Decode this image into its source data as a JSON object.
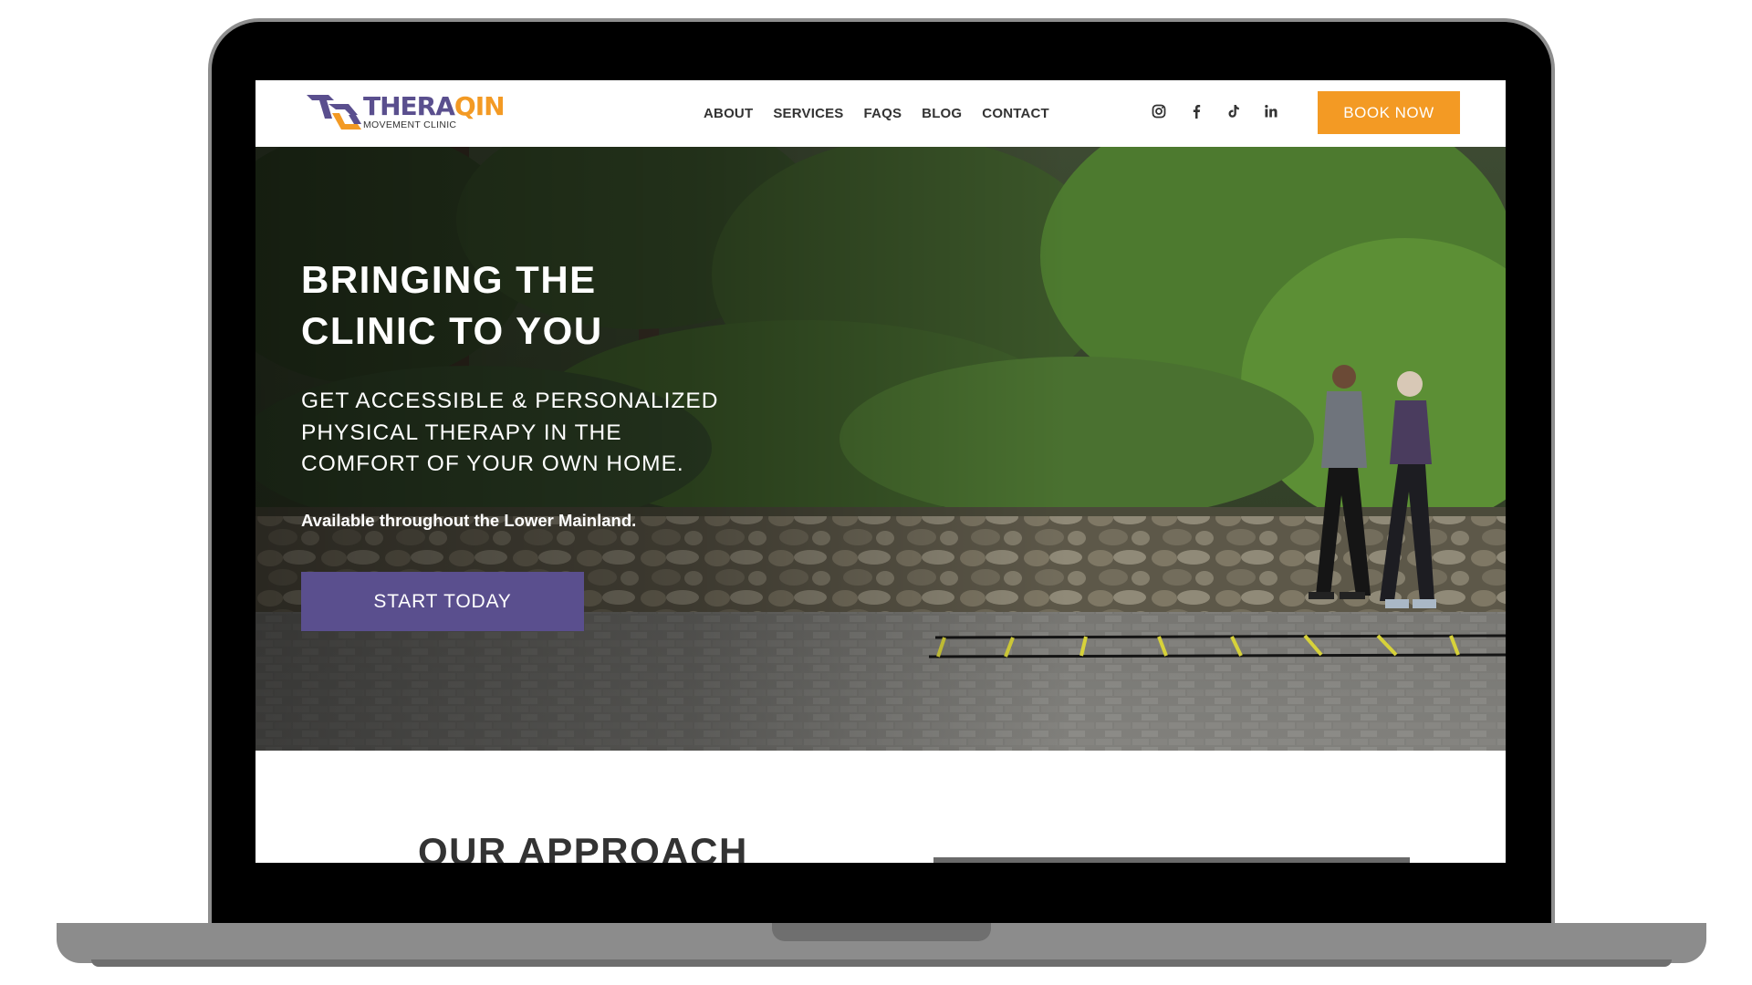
{
  "brand": {
    "name_part1": "THERA",
    "name_part2": "QIN",
    "tagline": "MOVEMENT CLINIC",
    "primary_color": "#5a4f8e",
    "accent_color": "#f39a24"
  },
  "nav": {
    "links": [
      "ABOUT",
      "SERVICES",
      "FAQS",
      "BLOG",
      "CONTACT"
    ],
    "social_icons": [
      "instagram-icon",
      "facebook-icon",
      "tiktok-icon",
      "linkedin-icon"
    ],
    "book_label": "BOOK NOW"
  },
  "hero": {
    "title_line1": "BRINGING THE",
    "title_line2": "CLINIC TO YOU",
    "subtitle_line1": "GET ACCESSIBLE & PERSONALIZED",
    "subtitle_line2": "PHYSICAL THERAPY IN THE",
    "subtitle_line3": "COMFORT OF YOUR OWN HOME.",
    "note": "Available throughout the Lower Mainland.",
    "cta_label": "START TODAY"
  },
  "approach": {
    "heading": "OUR APPROACH"
  }
}
